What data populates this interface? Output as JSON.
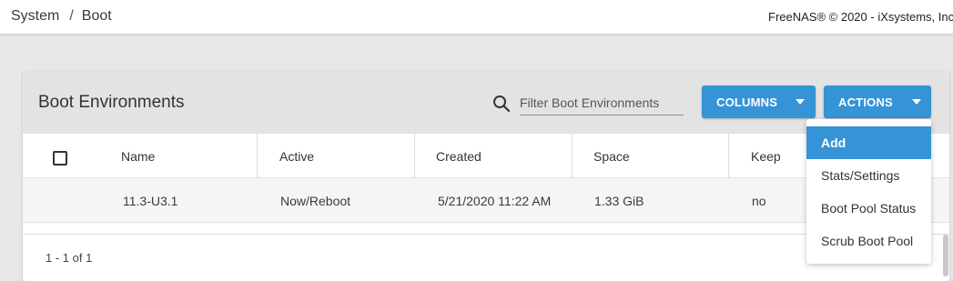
{
  "breadcrumb": {
    "parent": "System",
    "separator": "/",
    "current": "Boot"
  },
  "copyright": "FreeNAS® © 2020 - iXsystems, Inc",
  "card": {
    "title": "Boot Environments",
    "filter_placeholder": "Filter Boot Environments",
    "columns_button": "COLUMNS",
    "actions_button": "ACTIONS"
  },
  "table": {
    "headers": [
      "Name",
      "Active",
      "Created",
      "Space",
      "Keep"
    ],
    "rows": [
      {
        "name": "11.3-U3.1",
        "active": "Now/Reboot",
        "created": "5/21/2020 11:22 AM",
        "space": "1.33 GiB",
        "keep": "no"
      }
    ],
    "paging": "1 - 1 of 1"
  },
  "actions_menu": {
    "items": [
      "Add",
      "Stats/Settings",
      "Boot Pool Status",
      "Scrub Boot Pool"
    ],
    "highlighted": "Add"
  },
  "colors": {
    "accent": "#3593d6",
    "header_bg": "#e3e3e3",
    "page_bg": "#e8e8e8"
  },
  "icons": {
    "search": "search-icon",
    "dropdown": "caret-down-icon"
  }
}
